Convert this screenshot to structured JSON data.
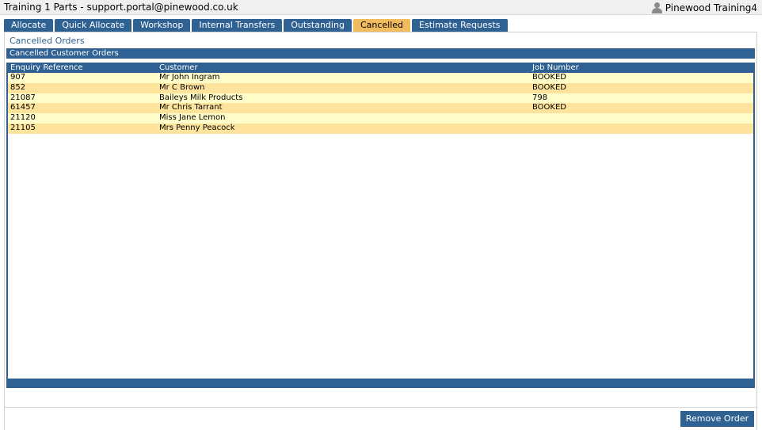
{
  "app": {
    "title": "Training 1 Parts - support.portal@pinewood.co.uk",
    "user_name": "Pinewood Training4",
    "user_icon": "user-icon"
  },
  "tabs": [
    {
      "label": "Allocate",
      "active": false
    },
    {
      "label": "Quick Allocate",
      "active": false
    },
    {
      "label": "Workshop",
      "active": false
    },
    {
      "label": "Internal Transfers",
      "active": false
    },
    {
      "label": "Outstanding",
      "active": false
    },
    {
      "label": "Cancelled",
      "active": true
    },
    {
      "label": "Estimate Requests",
      "active": false
    }
  ],
  "main": {
    "heading": "Cancelled Orders",
    "grid_title": "Cancelled Customer Orders",
    "columns": [
      "Enquiry Reference",
      "Customer",
      "Job Number"
    ],
    "rows": [
      {
        "ref": "907",
        "customer": "Mr John Ingram",
        "job": "BOOKED"
      },
      {
        "ref": "852",
        "customer": "Mr C Brown",
        "job": "BOOKED"
      },
      {
        "ref": "21087",
        "customer": "Baileys Milk Products",
        "job": "798"
      },
      {
        "ref": "61457",
        "customer": "Mr Chris Tarrant",
        "job": "BOOKED"
      },
      {
        "ref": "21120",
        "customer": "Miss Jane Lemon",
        "job": ""
      },
      {
        "ref": "21105",
        "customer": "Mrs Penny Peacock",
        "job": ""
      }
    ],
    "remove_button_label": "Remove Order"
  },
  "colors": {
    "accent": "#2f6193",
    "active_tab": "#f2bc5e",
    "row_light": "#fffdc9",
    "row_dark": "#fde39c"
  }
}
